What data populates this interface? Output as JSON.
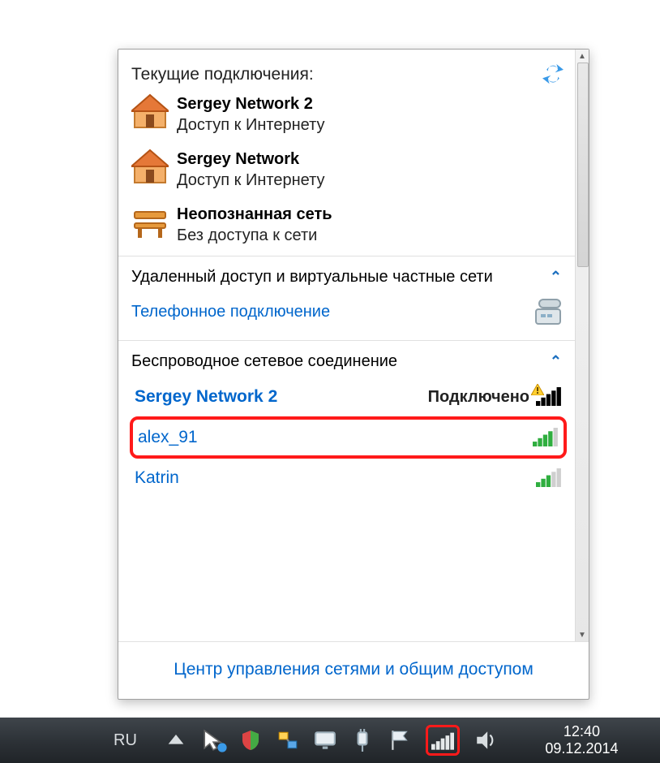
{
  "header": {
    "title": "Текущие подключения:"
  },
  "connections": [
    {
      "name": "Sergey Network  2",
      "status": "Доступ к Интернету",
      "icon": "house"
    },
    {
      "name": "Sergey Network",
      "status": "Доступ к Интернету",
      "icon": "house"
    },
    {
      "name": "Неопознанная сеть",
      "status": "Без доступа к сети",
      "icon": "bench"
    }
  ],
  "dialup": {
    "group_label": "Удаленный доступ и виртуальные частные сети",
    "phone_label": "Телефонное подключение"
  },
  "wireless": {
    "group_label": "Беспроводное сетевое соединение",
    "connected_label": "Подключено",
    "networks": [
      {
        "name": "Sergey Network 2",
        "connected": true,
        "signal": 5,
        "warn": true
      },
      {
        "name": "alex_91",
        "connected": false,
        "signal": 4,
        "warn": false,
        "highlight": true
      },
      {
        "name": "Katrin",
        "connected": false,
        "signal": 3,
        "warn": false
      }
    ]
  },
  "footer": {
    "link": "Центр управления сетями и общим доступом"
  },
  "taskbar": {
    "lang": "RU",
    "time": "12:40",
    "date": "09.12.2014"
  }
}
